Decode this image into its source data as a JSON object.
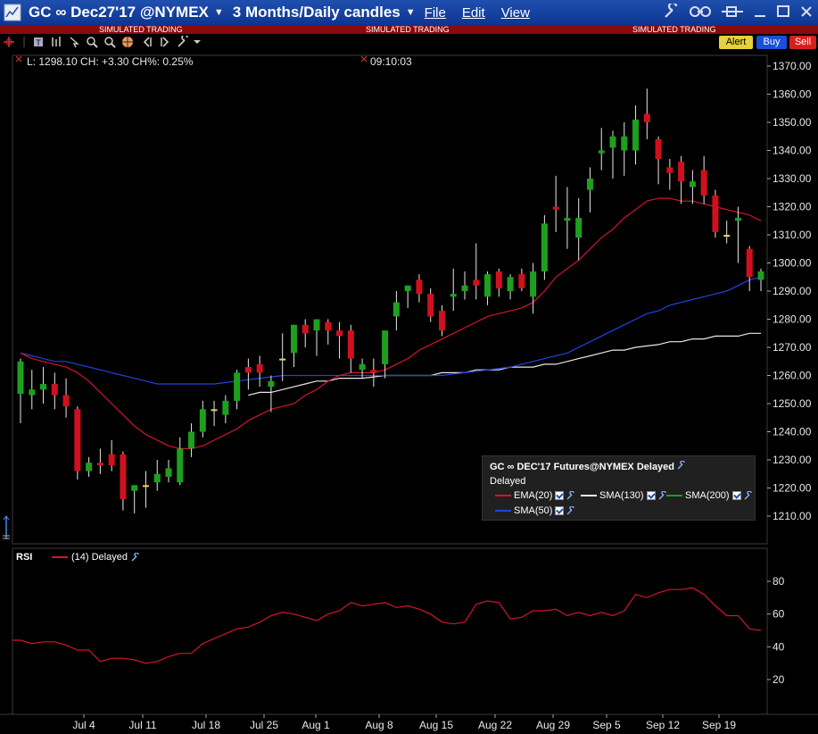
{
  "window": {
    "title": "GC ∞ Dec27'17 @NYMEX",
    "period": "3 Months/Daily candles",
    "menu": [
      "File",
      "Edit",
      "View"
    ]
  },
  "banner": {
    "text": "SIMULATED TRADING"
  },
  "orders": {
    "alert": "Alert",
    "buy": "Buy",
    "sell": "Sell"
  },
  "info": {
    "quote": "L: 1298.10 CH: +3.30 CH%: 0.25%",
    "time": "09:10:03"
  },
  "legend": {
    "title": "GC ∞ DEC'17 Futures@NYMEX Delayed",
    "subtitle": "Delayed",
    "items": [
      {
        "label": "EMA(20)",
        "color": "#d4152c"
      },
      {
        "label": "SMA(130)",
        "color": "#e8e8e8"
      },
      {
        "label": "SMA(200)",
        "color": "#1aa11a"
      },
      {
        "label": "SMA(50)",
        "color": "#1f44e0"
      }
    ]
  },
  "rsi": {
    "label": "RSI",
    "legend": "(14) Delayed",
    "color": "#d4152c"
  },
  "colors": {
    "up": "#1ea01e",
    "down": "#d0101e",
    "doji": "#e8d060",
    "wick": "#e8e8e8"
  },
  "chart_data": {
    "type": "candlestick",
    "x_tick_labels": [
      "Jul 4",
      "Jul 11",
      "Jul 18",
      "Jul 25",
      "Aug 1",
      "Aug 8",
      "Aug 15",
      "Aug 22",
      "Aug 29",
      "Sep 5",
      "Sep 12",
      "Sep 19"
    ],
    "y_ticks": [
      1210,
      1220,
      1230,
      1240,
      1250,
      1260,
      1270,
      1280,
      1290,
      1300,
      1310,
      1320,
      1330,
      1340,
      1350,
      1360,
      1370
    ],
    "ylim": [
      1203,
      1373
    ],
    "candles": [
      {
        "o": 1253.5,
        "h": 1266,
        "l": 1243,
        "c": 1265
      },
      {
        "o": 1253,
        "h": 1262,
        "l": 1248,
        "c": 1255
      },
      {
        "o": 1255,
        "h": 1263,
        "l": 1250,
        "c": 1257
      },
      {
        "o": 1257,
        "h": 1261,
        "l": 1248,
        "c": 1253
      },
      {
        "o": 1253,
        "h": 1259,
        "l": 1245,
        "c": 1249
      },
      {
        "o": 1248,
        "h": 1249,
        "l": 1223,
        "c": 1226
      },
      {
        "o": 1226,
        "h": 1231,
        "l": 1224,
        "c": 1229
      },
      {
        "o": 1229,
        "h": 1234,
        "l": 1225,
        "c": 1228
      },
      {
        "o": 1232,
        "h": 1237,
        "l": 1226,
        "c": 1228
      },
      {
        "o": 1232,
        "h": 1233,
        "l": 1212,
        "c": 1216
      },
      {
        "o": 1219,
        "h": 1221,
        "l": 1211,
        "c": 1221
      },
      {
        "o": 1221,
        "h": 1226,
        "l": 1213,
        "c": 1221
      },
      {
        "o": 1222,
        "h": 1230,
        "l": 1219,
        "c": 1225
      },
      {
        "o": 1224,
        "h": 1230,
        "l": 1222,
        "c": 1227
      },
      {
        "o": 1222,
        "h": 1238,
        "l": 1221,
        "c": 1234
      },
      {
        "o": 1234,
        "h": 1243,
        "l": 1231,
        "c": 1240
      },
      {
        "o": 1240,
        "h": 1251,
        "l": 1238,
        "c": 1248
      },
      {
        "o": 1248,
        "h": 1251,
        "l": 1242,
        "c": 1248
      },
      {
        "o": 1246,
        "h": 1253,
        "l": 1243,
        "c": 1251
      },
      {
        "o": 1251,
        "h": 1262,
        "l": 1248,
        "c": 1261
      },
      {
        "o": 1263,
        "h": 1266,
        "l": 1255,
        "c": 1261
      },
      {
        "o": 1264,
        "h": 1267,
        "l": 1256,
        "c": 1261
      },
      {
        "o": 1256,
        "h": 1260,
        "l": 1247,
        "c": 1258
      },
      {
        "o": 1266,
        "h": 1275,
        "l": 1258,
        "c": 1266
      },
      {
        "o": 1268,
        "h": 1278,
        "l": 1263,
        "c": 1278
      },
      {
        "o": 1278,
        "h": 1280,
        "l": 1270,
        "c": 1275
      },
      {
        "o": 1276,
        "h": 1280,
        "l": 1267,
        "c": 1280
      },
      {
        "o": 1279,
        "h": 1280,
        "l": 1271,
        "c": 1276
      },
      {
        "o": 1276,
        "h": 1279,
        "l": 1266,
        "c": 1274
      },
      {
        "o": 1276,
        "h": 1278,
        "l": 1261,
        "c": 1266
      },
      {
        "o": 1262,
        "h": 1266,
        "l": 1259,
        "c": 1264
      },
      {
        "o": 1262,
        "h": 1266,
        "l": 1256,
        "c": 1261
      },
      {
        "o": 1264,
        "h": 1275,
        "l": 1259,
        "c": 1276
      },
      {
        "o": 1281,
        "h": 1290,
        "l": 1276,
        "c": 1286
      },
      {
        "o": 1290,
        "h": 1292,
        "l": 1284,
        "c": 1292
      },
      {
        "o": 1294,
        "h": 1296,
        "l": 1286,
        "c": 1289
      },
      {
        "o": 1289,
        "h": 1291,
        "l": 1279,
        "c": 1281
      },
      {
        "o": 1283,
        "h": 1285,
        "l": 1274,
        "c": 1276
      },
      {
        "o": 1288,
        "h": 1298,
        "l": 1283,
        "c": 1289
      },
      {
        "o": 1290,
        "h": 1297,
        "l": 1287,
        "c": 1292
      },
      {
        "o": 1294,
        "h": 1307,
        "l": 1287,
        "c": 1292
      },
      {
        "o": 1288,
        "h": 1297,
        "l": 1285,
        "c": 1296
      },
      {
        "o": 1297,
        "h": 1298,
        "l": 1288,
        "c": 1291
      },
      {
        "o": 1290,
        "h": 1296,
        "l": 1287,
        "c": 1295
      },
      {
        "o": 1296,
        "h": 1298,
        "l": 1290,
        "c": 1291
      },
      {
        "o": 1288,
        "h": 1300,
        "l": 1282,
        "c": 1297
      },
      {
        "o": 1297,
        "h": 1317,
        "l": 1294,
        "c": 1314
      },
      {
        "o": 1320,
        "h": 1331,
        "l": 1311,
        "c": 1319
      },
      {
        "o": 1315,
        "h": 1327,
        "l": 1305,
        "c": 1316
      },
      {
        "o": 1309,
        "h": 1323,
        "l": 1301,
        "c": 1316
      },
      {
        "o": 1326,
        "h": 1334,
        "l": 1318,
        "c": 1330
      },
      {
        "o": 1339,
        "h": 1348,
        "l": 1333,
        "c": 1340
      },
      {
        "o": 1341,
        "h": 1347,
        "l": 1330,
        "c": 1345
      },
      {
        "o": 1340,
        "h": 1350,
        "l": 1331,
        "c": 1345
      },
      {
        "o": 1340,
        "h": 1356,
        "l": 1335,
        "c": 1351
      },
      {
        "o": 1353,
        "h": 1362,
        "l": 1344,
        "c": 1350
      },
      {
        "o": 1344,
        "h": 1345,
        "l": 1328,
        "c": 1337
      },
      {
        "o": 1334,
        "h": 1337,
        "l": 1326,
        "c": 1332
      },
      {
        "o": 1336,
        "h": 1338,
        "l": 1321,
        "c": 1329
      },
      {
        "o": 1327,
        "h": 1333,
        "l": 1321,
        "c": 1329
      },
      {
        "o": 1333,
        "h": 1338,
        "l": 1321,
        "c": 1324
      },
      {
        "o": 1324,
        "h": 1326,
        "l": 1309,
        "c": 1311
      },
      {
        "o": 1310,
        "h": 1315,
        "l": 1307,
        "c": 1310
      },
      {
        "o": 1315,
        "h": 1320,
        "l": 1300,
        "c": 1316
      },
      {
        "o": 1305,
        "h": 1306,
        "l": 1290,
        "c": 1295
      },
      {
        "o": 1294,
        "h": 1298,
        "l": 1290,
        "c": 1297
      }
    ],
    "ema20": [
      1268,
      1266,
      1265,
      1264,
      1263,
      1261,
      1258,
      1254,
      1250,
      1246,
      1242,
      1239,
      1237,
      1235,
      1234,
      1234,
      1235,
      1237,
      1239,
      1241,
      1244,
      1246,
      1248,
      1249,
      1250,
      1253,
      1255,
      1258,
      1260,
      1261,
      1261,
      1261,
      1262,
      1264,
      1266,
      1269,
      1271,
      1273,
      1275,
      1277,
      1279,
      1281,
      1282,
      1283,
      1284,
      1286,
      1290,
      1295,
      1298,
      1301,
      1305,
      1309,
      1312,
      1316,
      1319,
      1322,
      1323,
      1323,
      1322,
      1322,
      1321,
      1320,
      1319,
      1318,
      1317,
      1315
    ],
    "sma50": [
      1268,
      1267,
      1266,
      1265,
      1265,
      1264,
      1263,
      1262,
      1261,
      1260,
      1259,
      1258,
      1257,
      1257,
      1257,
      1257,
      1257,
      1257,
      1257.5,
      1258,
      1258.5,
      1259,
      1259.5,
      1260,
      1260,
      1260,
      1260,
      1260,
      1260,
      1260,
      1260,
      1260,
      1260,
      1260,
      1260,
      1260,
      1260,
      1260,
      1260.5,
      1261,
      1261.5,
      1262,
      1262.5,
      1263,
      1264,
      1265,
      1266,
      1267,
      1268,
      1270,
      1272,
      1274,
      1276,
      1278,
      1280,
      1282,
      1283,
      1285,
      1286,
      1287,
      1288,
      1289,
      1290,
      1292,
      1294,
      1295
    ],
    "sma130": [
      null,
      null,
      null,
      null,
      null,
      null,
      null,
      null,
      null,
      null,
      null,
      null,
      null,
      null,
      null,
      null,
      null,
      null,
      null,
      null,
      1253,
      1254,
      1254,
      1255,
      1256,
      1257,
      1258,
      1258,
      1259,
      1259,
      1259,
      1259.5,
      1260,
      1260,
      1260,
      1260,
      1260,
      1261,
      1261,
      1261,
      1262,
      1262,
      1262,
      1263,
      1263,
      1263,
      1264,
      1264,
      1265,
      1266,
      1267,
      1268,
      1269,
      1269,
      1270,
      1270.5,
      1271,
      1272,
      1272,
      1273,
      1273,
      1274,
      1274,
      1274,
      1275,
      1275
    ],
    "rsi": {
      "ylim": [
        0,
        100
      ],
      "y_ticks": [
        20,
        40,
        60,
        80
      ],
      "values": [
        44,
        42,
        43,
        43,
        41,
        38,
        38,
        31,
        33,
        33,
        32,
        30,
        31,
        34,
        36,
        36,
        42,
        45,
        48,
        51,
        52,
        55,
        59,
        61,
        60,
        58,
        56,
        60,
        62,
        67,
        65,
        66,
        67,
        64,
        65,
        63,
        60,
        55,
        54,
        55,
        66,
        68,
        67,
        57,
        58,
        62,
        62,
        63,
        59,
        61,
        59,
        61,
        59,
        62,
        72,
        70,
        73,
        75,
        75,
        76,
        72,
        65,
        59,
        59,
        51,
        50
      ]
    }
  }
}
